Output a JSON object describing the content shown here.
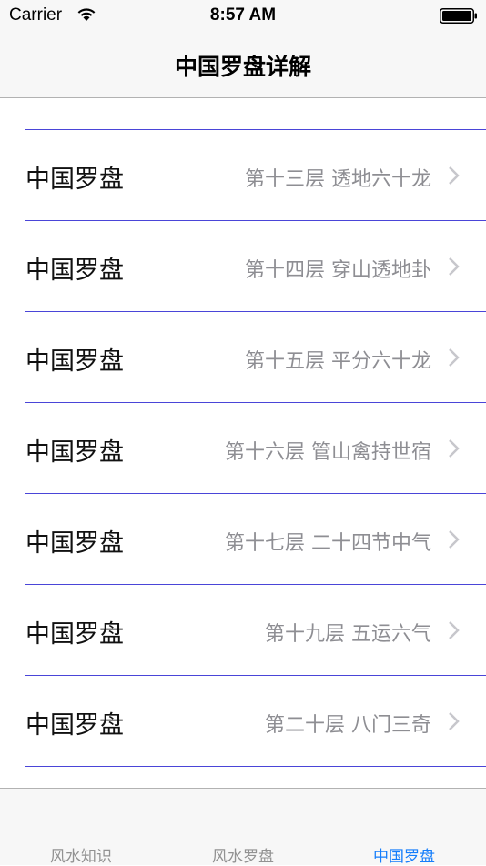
{
  "status_bar": {
    "carrier": "Carrier",
    "time": "8:57 AM"
  },
  "nav": {
    "title": "中国罗盘详解"
  },
  "rows": [
    {
      "title": "中国罗盘",
      "detail": "第十三层 透地六十龙"
    },
    {
      "title": "中国罗盘",
      "detail": "第十四层 穿山透地卦"
    },
    {
      "title": "中国罗盘",
      "detail": "第十五层 平分六十龙"
    },
    {
      "title": "中国罗盘",
      "detail": "第十六层 管山禽持世宿"
    },
    {
      "title": "中国罗盘",
      "detail": "第十七层 二十四节中气"
    },
    {
      "title": "中国罗盘",
      "detail": "第十九层 五运六气"
    },
    {
      "title": "中国罗盘",
      "detail": "第二十层 八门三奇"
    }
  ],
  "tabs": [
    {
      "label": "风水知识",
      "active": false
    },
    {
      "label": "风水罗盘",
      "active": false
    },
    {
      "label": "中国罗盘",
      "active": true
    }
  ],
  "colors": {
    "separator": "#4a45d8",
    "active_tab": "#157efb",
    "detail_text": "#8e8e93",
    "inactive_tab": "#929292"
  },
  "icons": [
    "wifi-icon",
    "battery-icon",
    "chevron-right-icon"
  ]
}
